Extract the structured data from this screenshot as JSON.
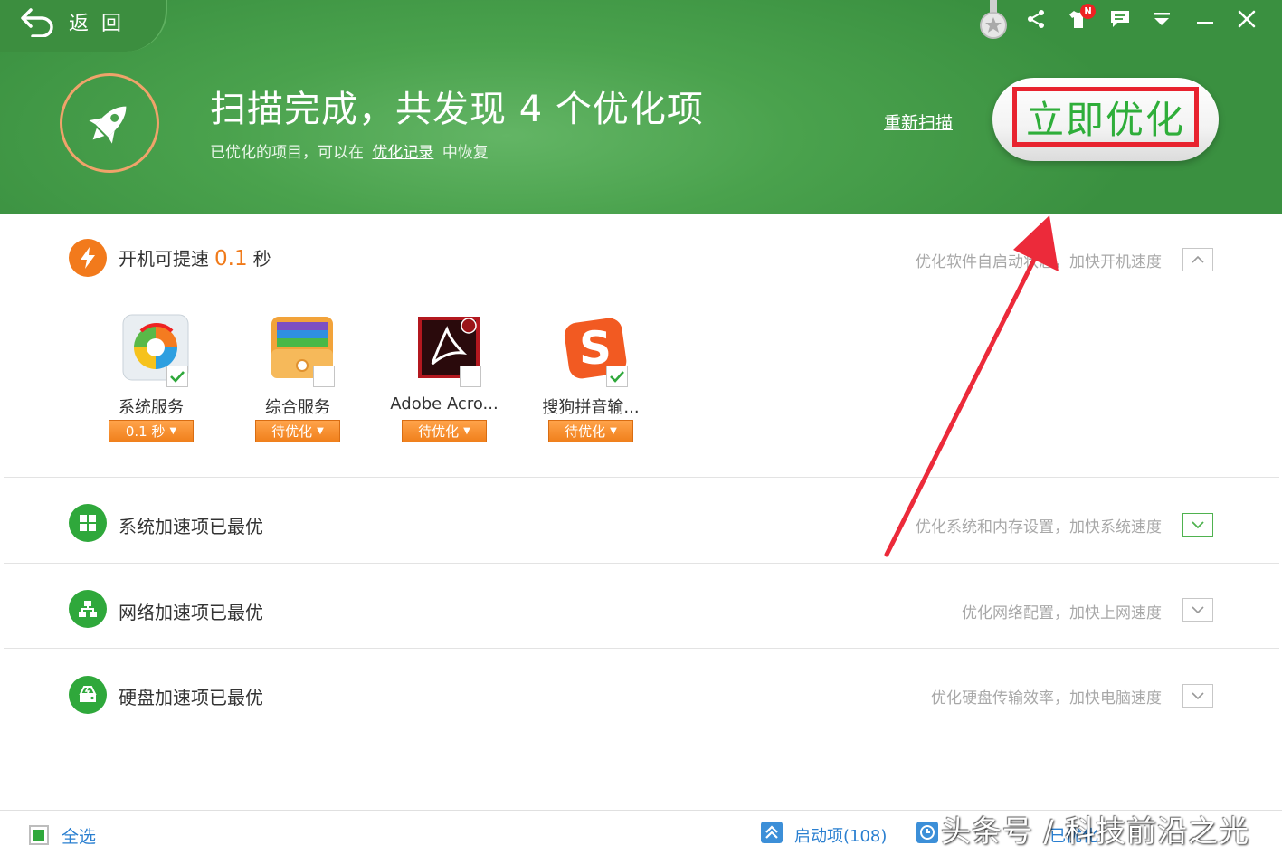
{
  "header": {
    "back_label": "返回",
    "title": "扫描完成，共发现 4 个优化项",
    "subtitle_prefix": "已优化的项目，可以在",
    "subtitle_link": "优化记录",
    "subtitle_suffix": "中恢复",
    "rescan_label": "重新扫描",
    "optimize_label": "立即优化",
    "notification_badge": "N"
  },
  "colors": {
    "header_green": "#4aa24d",
    "accent_orange": "#f07a1a",
    "optimize_text": "#2fae3a",
    "highlight_red": "#e8232f",
    "link_blue": "#2a7fd0"
  },
  "boot": {
    "title_prefix": "开机可提速",
    "speed_value": "0.1",
    "speed_unit": "秒",
    "description": "优化软件自启动状态，加快开机速度",
    "apps": [
      {
        "name": "系统服务",
        "status": "0.1 秒",
        "checked": true,
        "icon": "system-service-icon"
      },
      {
        "name": "综合服务",
        "status": "待优化",
        "checked": false,
        "icon": "combined-service-icon"
      },
      {
        "name": "Adobe Acro...",
        "status": "待优化",
        "checked": false,
        "icon": "adobe-acrobat-icon"
      },
      {
        "name": "搜狗拼音输...",
        "status": "待优化",
        "checked": true,
        "icon": "sogou-pinyin-icon"
      }
    ]
  },
  "sections": [
    {
      "title": "系统加速项已最优",
      "description": "优化系统和内存设置，加快系统速度",
      "icon": "windows-icon"
    },
    {
      "title": "网络加速项已最优",
      "description": "优化网络配置，加快上网速度",
      "icon": "network-icon"
    },
    {
      "title": "硬盘加速项已最优",
      "description": "优化硬盘传输效率，加快电脑速度",
      "icon": "harddisk-icon"
    }
  ],
  "footer": {
    "select_all_label": "全选",
    "startup_label": "启动项(108)",
    "record_label": "已优化",
    "watermark": "头条号 / 科技前沿之光"
  }
}
